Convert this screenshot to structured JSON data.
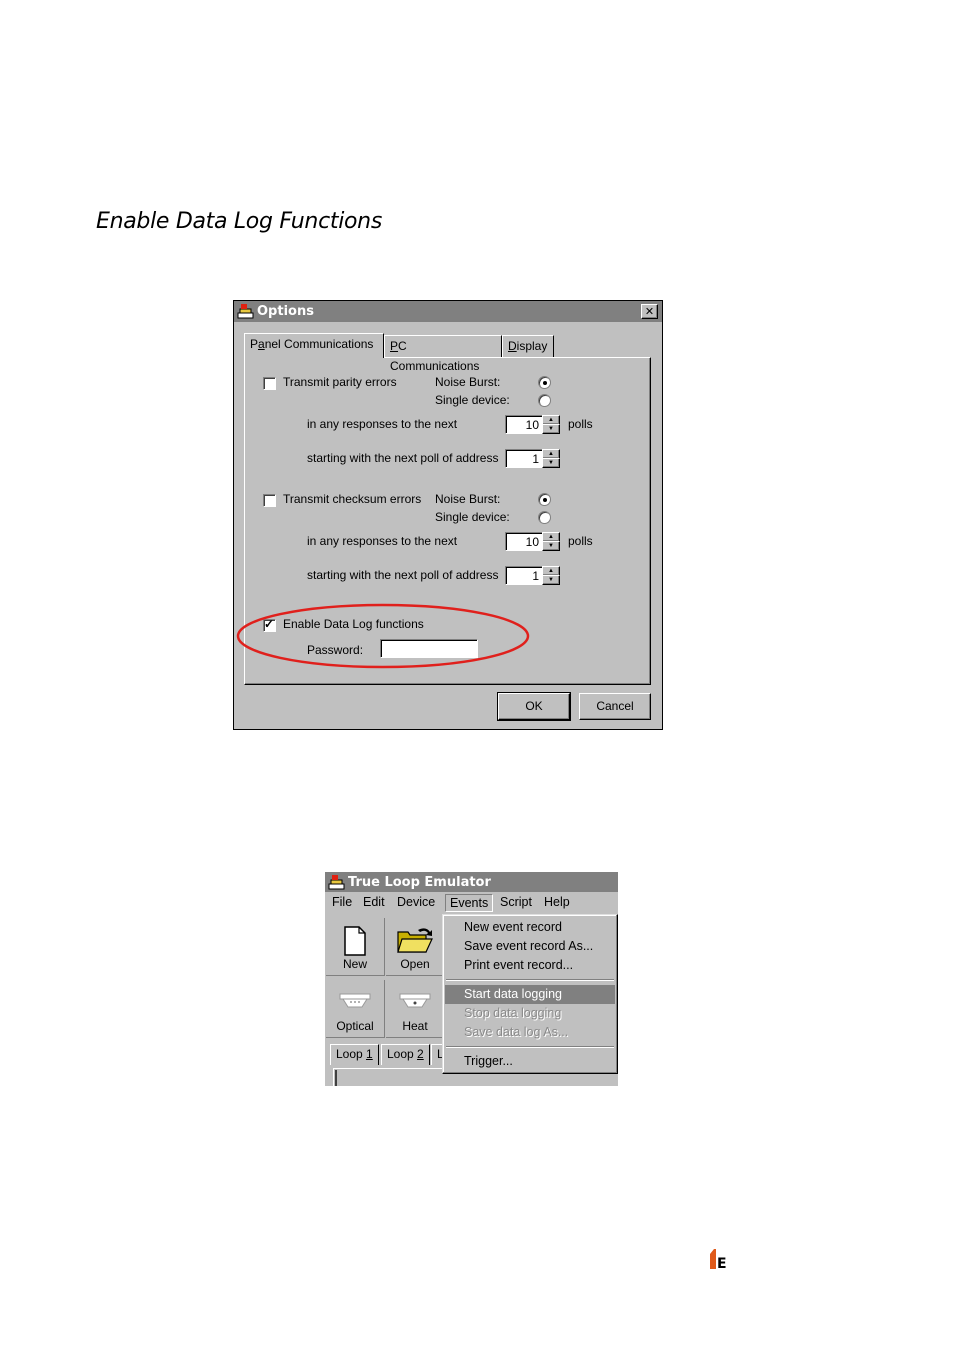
{
  "heading": "Enable Data Log Functions",
  "options_dialog": {
    "title": "Options",
    "close_glyph": "✕",
    "tabs": [
      {
        "label_pre": "P",
        "label_u": "a",
        "label_post": "nel Communications"
      },
      {
        "label_pre": "",
        "label_u": "P",
        "label_post": "C Communications"
      },
      {
        "label_pre": "",
        "label_u": "D",
        "label_post": "isplay"
      }
    ],
    "parity": {
      "checkbox_label": "Transmit parity errors",
      "noise_burst_label": "Noise Burst:",
      "single_device_label": "Single device:",
      "responses_label": "in any responses to the next",
      "responses_value": "10",
      "polls_label": "polls",
      "address_label": "starting with the next poll of address",
      "address_value": "1"
    },
    "checksum": {
      "checkbox_label": "Transmit checksum errors",
      "noise_burst_label": "Noise Burst:",
      "single_device_label": "Single device:",
      "responses_label": "in any responses to the next",
      "responses_value": "10",
      "polls_label": "polls",
      "address_label": "starting with the next poll of address",
      "address_value": "1"
    },
    "datalog": {
      "checkbox_label": "Enable Data Log functions",
      "password_label": "Password:",
      "password_value": ""
    },
    "ok_label": "OK",
    "cancel_label": "Cancel"
  },
  "emulator": {
    "title": "True Loop Emulator",
    "menubar": [
      "File",
      "Edit",
      "Device",
      "Events",
      "Script",
      "Help"
    ],
    "toolbar": {
      "new_label": "New",
      "open_label": "Open",
      "optical_label": "Optical",
      "heat_label": "Heat"
    },
    "loop_tabs": [
      {
        "pre": "Loop ",
        "u": "1"
      },
      {
        "pre": "Loop ",
        "u": "2"
      },
      {
        "pre": "L",
        "u": ""
      }
    ],
    "events_menu": {
      "group1": [
        "New event record",
        "Save event record As...",
        "Print event record..."
      ],
      "group2": [
        "Start data logging",
        "Stop data logging",
        "Save data log As..."
      ],
      "group3": [
        "Trigger..."
      ]
    }
  },
  "colors": {
    "highlight_ellipse": "#e0201c",
    "logo": "#e05a1a"
  },
  "footer_logo_text": "E"
}
